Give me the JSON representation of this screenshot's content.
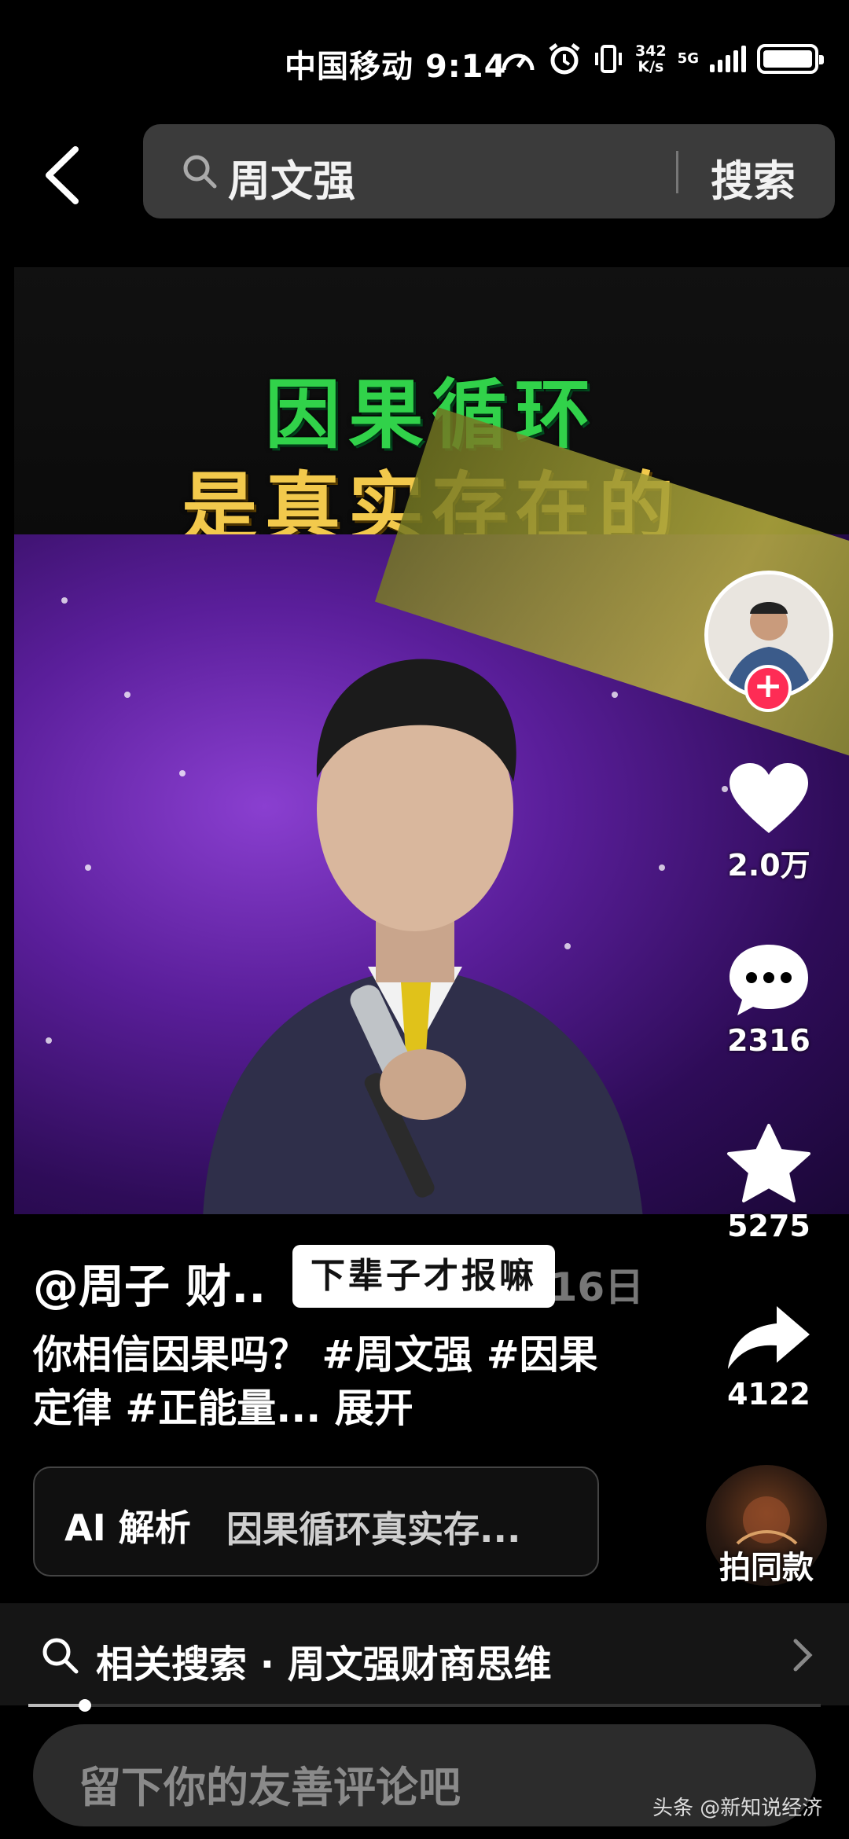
{
  "status_bar": {
    "carrier": "中国移动",
    "time": "9:14",
    "net_speed_value": "342",
    "net_speed_unit": "K/s",
    "network": "5G"
  },
  "search": {
    "query": "周文强",
    "button_label": "搜索"
  },
  "video": {
    "overlay_line1": "因果循环",
    "overlay_line2": "是真实存在的"
  },
  "actions": {
    "likes": "2.0万",
    "comments": "2316",
    "favorites": "5275",
    "shares": "4122",
    "follow_symbol": "+"
  },
  "post": {
    "author": "@周子 财..",
    "date_partial": "07月16日",
    "sticker_text": "下辈子才报嘛",
    "description": "你相信因果吗？ #周文强 #因果定律 #正能量...",
    "expand_label": "展开"
  },
  "ai": {
    "label": "AI 解析",
    "summary": "因果循环真实存..."
  },
  "music": {
    "label": "拍同款"
  },
  "related": {
    "text": "相关搜索 · 周文强财商思维"
  },
  "comment": {
    "placeholder": "留下你的友善评论吧"
  },
  "watermark": "头条 @新知说经济",
  "colors": {
    "accent_red": "#fe2c55",
    "overlay_green": "#31d24a",
    "overlay_gold": "#f2c94c"
  },
  "progress": {
    "fraction": 0.07
  }
}
